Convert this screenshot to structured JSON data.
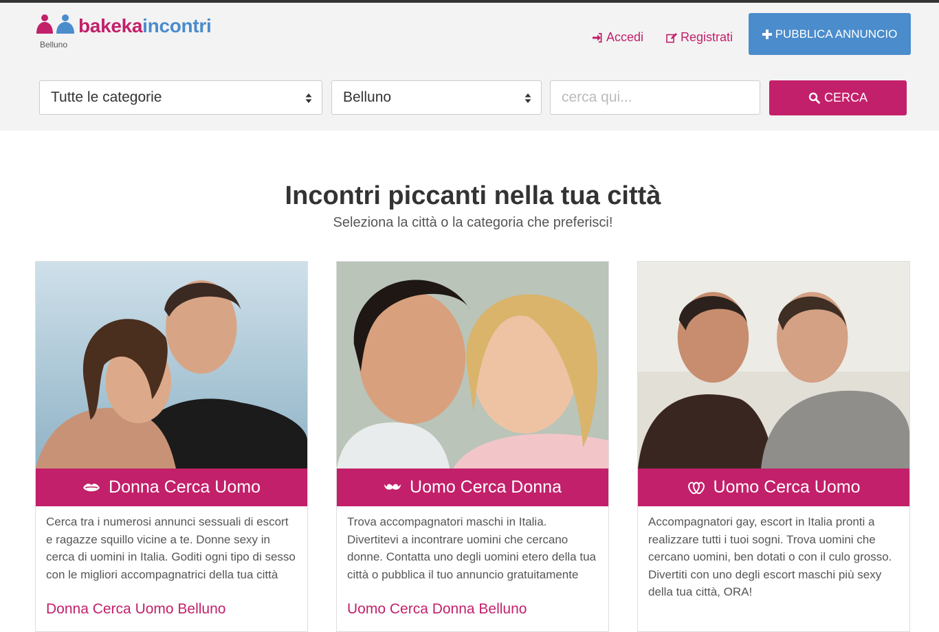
{
  "logo": {
    "part1": "bakeka",
    "part2": "incontri",
    "city": "Belluno"
  },
  "nav": {
    "login_label": "Accedi",
    "register_label": "Registrati",
    "publish_label": "PUBBLICA ANNUNCIO"
  },
  "search": {
    "category_value": "Tutte le categorie",
    "city_value": "Belluno",
    "query_placeholder": "cerca qui...",
    "button_label": "CERCA"
  },
  "hero": {
    "title": "Incontri piccanti nella tua città",
    "subtitle": "Seleziona la città o la categoria che preferisci!"
  },
  "cards": [
    {
      "icon": "lips-icon",
      "title": "Donna Cerca Uomo",
      "text": "Cerca tra i numerosi annunci sessuali di escort e ragazze squillo vicine a te. Donne sexy in cerca di uomini in Italia. Goditi ogni tipo di sesso con le migliori accompagnatrici della tua città",
      "link": "Donna Cerca Uomo Belluno"
    },
    {
      "icon": "mustache-icon",
      "title": "Uomo Cerca Donna",
      "text": "Trova accompagnatori maschi in Italia. Divertitevi a incontrare uomini che cercano donne. Contatta uno degli uomini etero della tua città o pubblica il tuo annuncio gratuitamente",
      "link": "Uomo Cerca Donna Belluno"
    },
    {
      "icon": "double-heart-icon",
      "title": "Uomo Cerca Uomo",
      "text": "Accompagnatori gay, escort in Italia pronti a realizzare tutti i tuoi sogni. Trova uomini che cercano uomini, ben dotati o con il culo grosso. Divertiti con uno degli escort maschi più sexy della tua città, ORA!",
      "link": ""
    }
  ],
  "colors": {
    "brand_pink": "#c2206a",
    "brand_blue": "#4a8ccc",
    "header_bg": "#f3f3f3"
  }
}
